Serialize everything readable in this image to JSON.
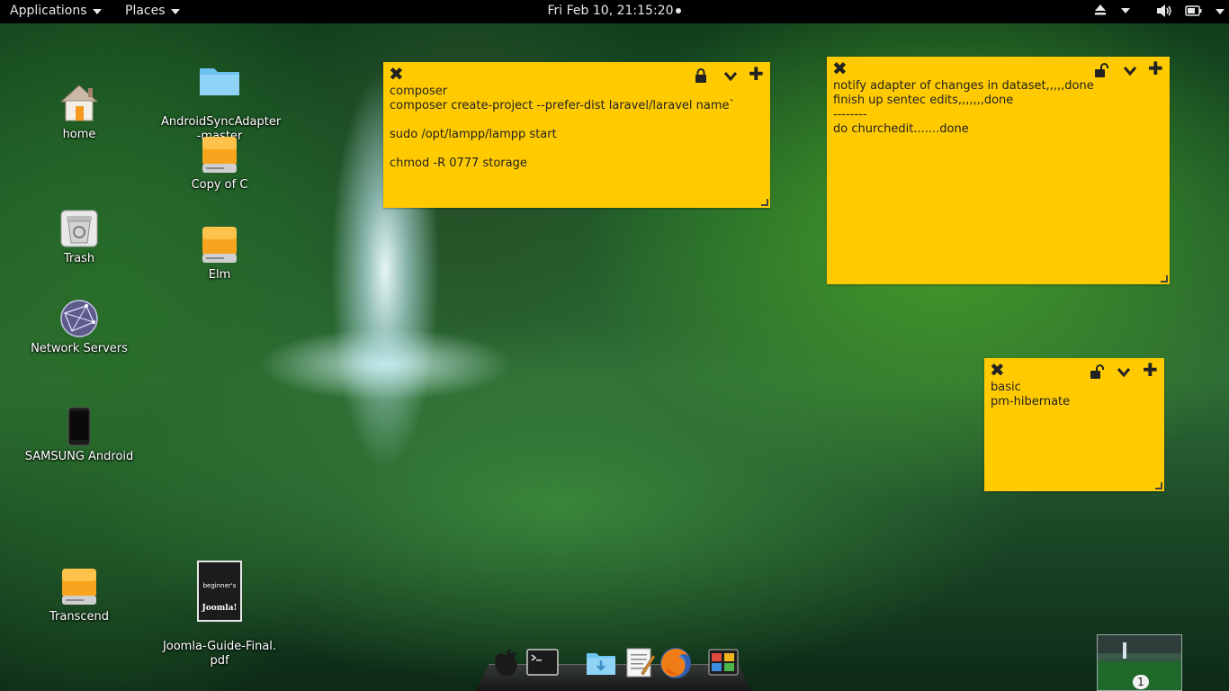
{
  "topbar": {
    "applications_label": "Applications",
    "places_label": "Places",
    "clock": "Fri Feb 10, 21:15:20"
  },
  "desktop_icons": [
    {
      "label": "home"
    },
    {
      "label": "AndroidSyncAdapter\n-master"
    },
    {
      "label": "Copy of C"
    },
    {
      "label": "Trash"
    },
    {
      "label": "Elm"
    },
    {
      "label": "Network Servers"
    },
    {
      "label": "SAMSUNG Android"
    },
    {
      "label": "Transcend"
    },
    {
      "label": "Joomla-Guide-Final.\npdf"
    }
  ],
  "joomla_cover": {
    "line1": "beginner's",
    "line2": "Joomla!"
  },
  "notes": [
    {
      "text": "composer\ncomposer create-project --prefer-dist laravel/laravel name`\n\nsudo /opt/lampp/lampp start\n\nchmod -R 0777 storage",
      "locked": true
    },
    {
      "text": "notify adapter of changes in dataset,,,,,done\nfinish up sentec edits,,,,,,,done\n--------\ndo churchedit.......done",
      "locked": false
    },
    {
      "text": "basic\npm-hibernate",
      "locked": false
    }
  ],
  "dock": {
    "items": [
      "apple-icon",
      "terminal-icon",
      "downloads-folder-icon",
      "text-editor-icon",
      "firefox-icon",
      "system-monitor-icon"
    ]
  },
  "workspace": {
    "number": "1"
  }
}
